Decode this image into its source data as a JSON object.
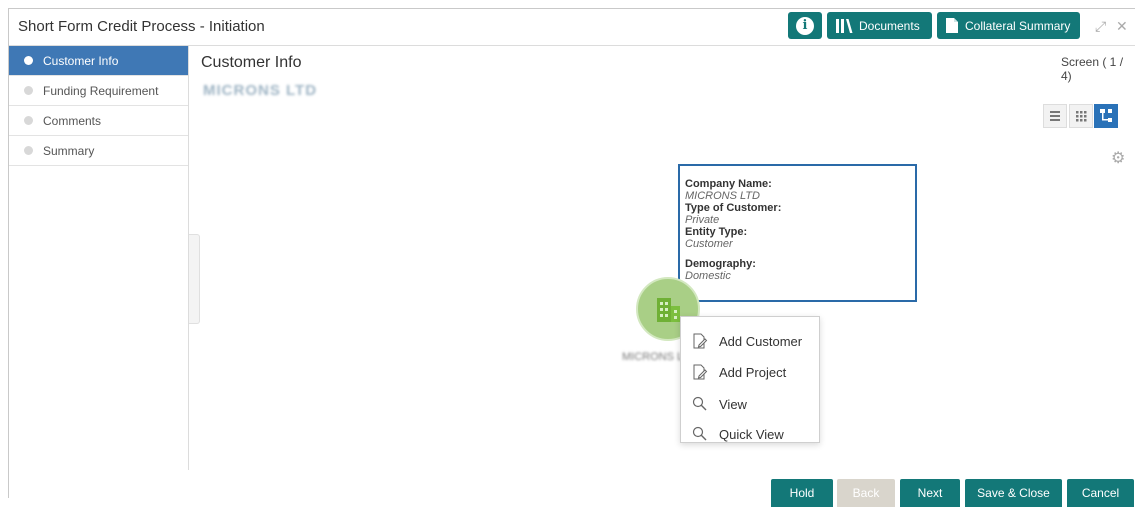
{
  "header": {
    "title": "Short Form Credit Process - Initiation",
    "info_icon": "info-icon",
    "documents_label": "Documents",
    "collateral_label": "Collateral Summary"
  },
  "sidebar": {
    "items": [
      {
        "label": "Customer Info",
        "active": true
      },
      {
        "label": "Funding Requirement",
        "active": false
      },
      {
        "label": "Comments",
        "active": false
      },
      {
        "label": "Summary",
        "active": false
      }
    ]
  },
  "main": {
    "title": "Customer Info",
    "screen_indicator": "Screen ( 1 / 4)",
    "company_name_blurred": "MICRONS LTD"
  },
  "tooltip": {
    "company_name_label": "Company Name:",
    "company_name_value": "MICRONS LTD",
    "customer_type_label": "Type of Customer:",
    "customer_type_value": "Private",
    "entity_type_label": "Entity Type:",
    "entity_type_value": "Customer",
    "demography_label": "Demography:",
    "demography_value": "Domestic"
  },
  "node": {
    "label_blurred": "MICRONS LTD"
  },
  "context_menu": {
    "items": [
      "Add Customer",
      "Add Project",
      "View",
      "Quick View"
    ]
  },
  "footer": {
    "hold": "Hold",
    "back": "Back",
    "next": "Next",
    "save_close": "Save & Close",
    "cancel": "Cancel"
  },
  "colors": {
    "primary": "#137878",
    "active_step": "#3f78b5",
    "node_fill": "#a9cf86"
  }
}
